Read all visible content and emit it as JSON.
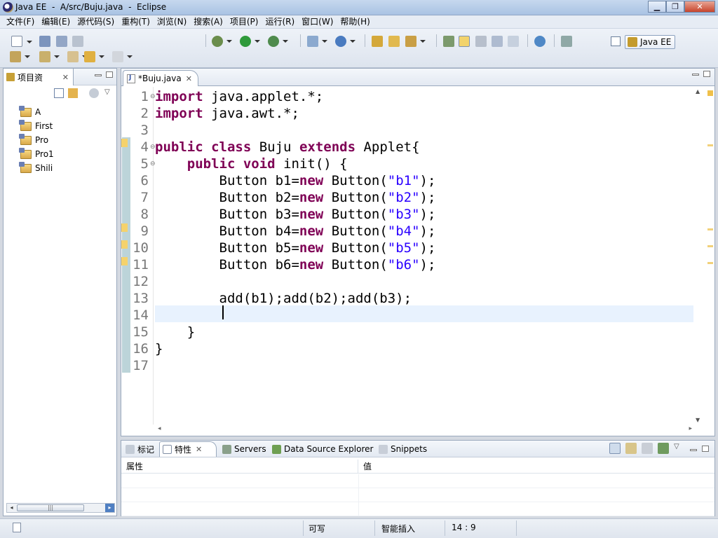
{
  "window": {
    "title": "Java EE  -  A/src/Buju.java  -  Eclipse"
  },
  "menu": [
    "文件(F)",
    "编辑(E)",
    "源代码(S)",
    "重构(T)",
    "浏览(N)",
    "搜索(A)",
    "项目(P)",
    "运行(R)",
    "窗口(W)",
    "帮助(H)"
  ],
  "perspective": {
    "label": "Java EE"
  },
  "project_explorer": {
    "tab_label": "项目资",
    "projects": [
      "A",
      "First",
      "Pro",
      "Pro1",
      "Shili"
    ]
  },
  "editor": {
    "tab_label": "*Buju.java",
    "line_numbers": [
      "1",
      "2",
      "3",
      "4",
      "5",
      "6",
      "7",
      "8",
      "9",
      "10",
      "11",
      "12",
      "13",
      "14",
      "15",
      "16",
      "17"
    ],
    "tokens": {
      "import": "import",
      "pkg_applet": " java.applet.*;",
      "pkg_awt": " java.awt.*;",
      "public": "public",
      "class": "class",
      "class_name": " Buju ",
      "extends": "extends",
      "super": " Applet{",
      "void": "void",
      "init": " init() {",
      "btn_prefix": "Button",
      "new": "new",
      "close_brace_inner": "}",
      "close_brace_outer": "}",
      "add_line": "add(b1);add(b2);add(b3);"
    },
    "buttons": [
      {
        "decl": " b1=",
        "ctor": " Button(",
        "literal": "\"b1\"",
        "end": ");"
      },
      {
        "decl": " b2=",
        "ctor": " Button(",
        "literal": "\"b2\"",
        "end": ");"
      },
      {
        "decl": " b3=",
        "ctor": " Button(",
        "literal": "\"b3\"",
        "end": ");"
      },
      {
        "decl": " b4=",
        "ctor": " Button(",
        "literal": "\"b4\"",
        "end": ");"
      },
      {
        "decl": " b5=",
        "ctor": " Button(",
        "literal": "\"b5\"",
        "end": ");"
      },
      {
        "decl": " b6=",
        "ctor": " Button(",
        "literal": "\"b6\"",
        "end": ");"
      }
    ],
    "colors": {
      "keyword": "#7f0055",
      "string": "#2a00ff",
      "current_line": "#e8f2fe"
    }
  },
  "bottom_panel": {
    "tabs": [
      {
        "label": "标记"
      },
      {
        "label": "特性"
      },
      {
        "label": "Servers"
      },
      {
        "label": "Data Source Explorer"
      },
      {
        "label": "Snippets"
      }
    ],
    "columns": [
      "属性",
      "值"
    ]
  },
  "status": {
    "writable": "可写",
    "insert_mode": "智能插入",
    "position": "14 : 9"
  }
}
